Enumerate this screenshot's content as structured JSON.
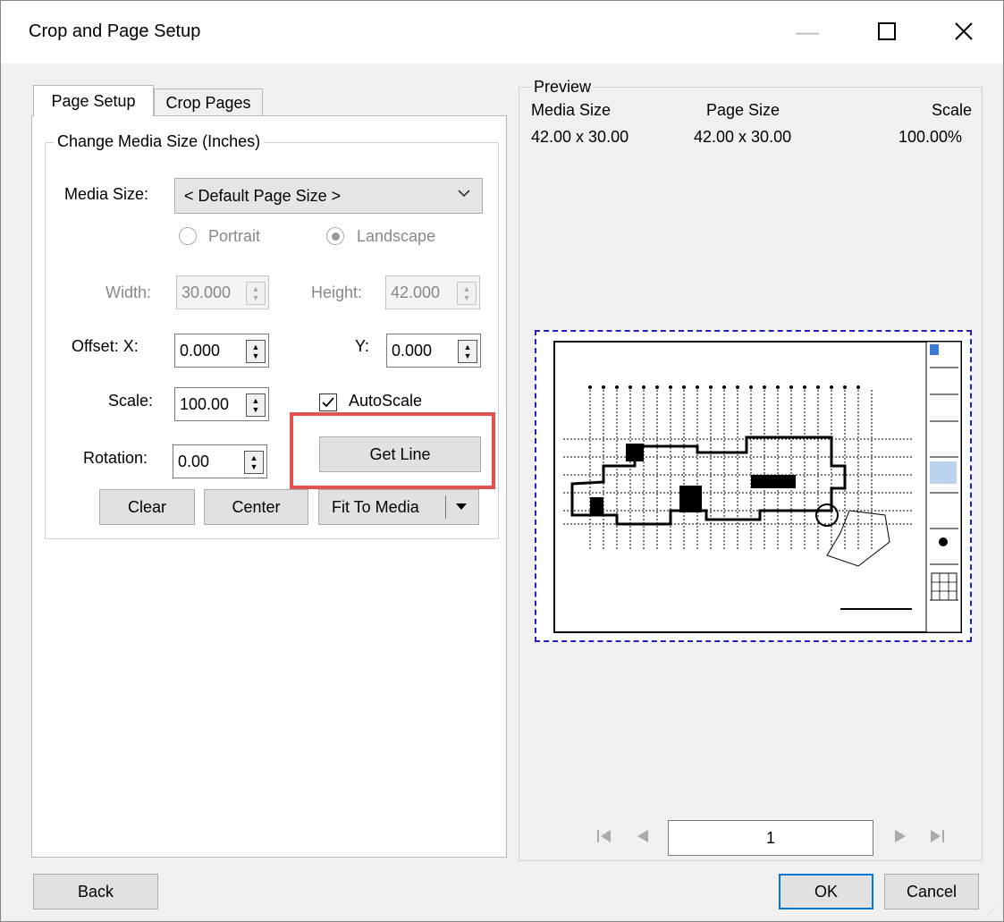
{
  "window": {
    "title": "Crop and Page Setup"
  },
  "tabs": [
    {
      "label": "Page Setup",
      "active": true
    },
    {
      "label": "Crop Pages",
      "active": false
    }
  ],
  "group": {
    "title": "Change Media Size (Inches)"
  },
  "media_size": {
    "label": "Media Size:",
    "value": "< Default Page Size >"
  },
  "orientation": {
    "portrait": "Portrait",
    "landscape": "Landscape",
    "selected": "Landscape"
  },
  "dimensions": {
    "width_label": "Width:",
    "width_value": "30.000",
    "height_label": "Height:",
    "height_value": "42.000"
  },
  "offset": {
    "label": "Offset:  X:",
    "x_value": "0.000",
    "y_label": "Y:",
    "y_value": "0.000"
  },
  "scale": {
    "label": "Scale:",
    "value": "100.00",
    "autoscale_label": "AutoScale",
    "autoscale_checked": true
  },
  "rotation": {
    "label": "Rotation:",
    "value": "0.00"
  },
  "buttons": {
    "get_line": "Get Line",
    "clear": "Clear",
    "center": "Center",
    "fit_to_media": "Fit To Media",
    "back": "Back",
    "ok": "OK",
    "cancel": "Cancel"
  },
  "preview": {
    "label": "Preview",
    "media_size_header": "Media Size",
    "media_size_value": "42.00 x 30.00",
    "page_size_header": "Page Size",
    "page_size_value": "42.00 x 30.00",
    "scale_header": "Scale",
    "scale_value": "100.00%",
    "page_number": "1"
  },
  "colors": {
    "highlight": "#e25050",
    "page_border": "#2020c0",
    "ok_border": "#0078d7"
  }
}
